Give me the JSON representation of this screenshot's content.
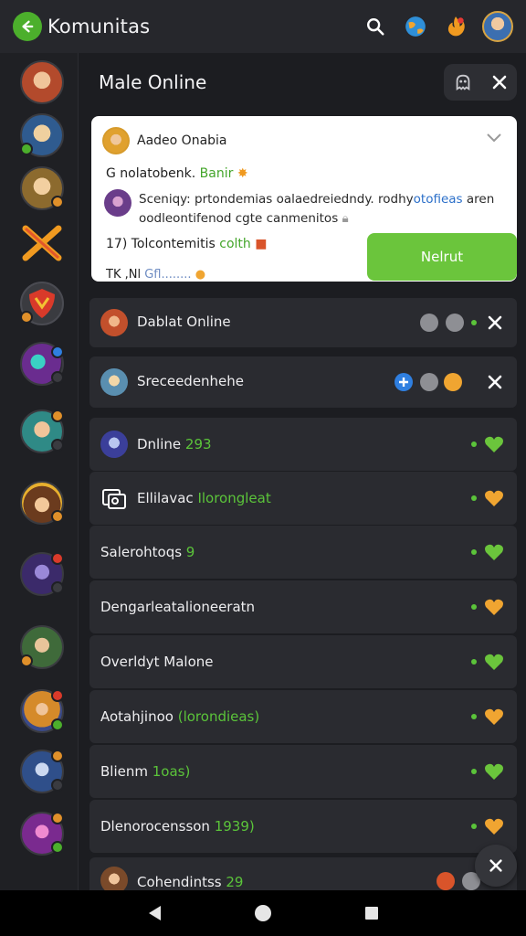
{
  "topbar": {
    "title": "Komunitas",
    "icons": [
      "back-arrow-icon",
      "search-icon",
      "globe-icon",
      "flame-icon",
      "profile-avatar"
    ],
    "accent": "#4caf2c"
  },
  "section": {
    "title": "Male Online",
    "icons": [
      "ghost-icon",
      "close-icon"
    ]
  },
  "card": {
    "name": "Aadeo Onabia",
    "line1_prefix": "G nolatobenk.",
    "line1_highlight": "Banir",
    "message_part1": "Sceniqy: prtondemias oalaedreiedndy. rodhy",
    "message_highlight": "otofieas",
    "message_part2": " aren oodleontifenod cgte canmenitos",
    "line3_prefix": "17) Tolcontemitis",
    "line3_highlight": "colth",
    "line4_prefix": "TK ,Nl",
    "line4_highlight": "Gfl........",
    "action_label": "Nelrut",
    "button_color": "#6bc53c"
  },
  "rows": [
    {
      "label": "Dablat Online",
      "highlight": "",
      "trail": "status-dots",
      "closable": true
    },
    {
      "label": "Sreceedenhehe",
      "highlight": "",
      "trail": "status-dots",
      "closable": true
    },
    {
      "label": "Dnline ",
      "highlight": "293",
      "trail": "heart-green",
      "closable": false
    },
    {
      "label": "Ellilavac ",
      "highlight": "Ilorongleat",
      "trail": "heart-orange",
      "closable": false
    },
    {
      "label": "Salerohtoqs ",
      "highlight": "9",
      "trail": "heart-green",
      "closable": false
    },
    {
      "label": "Dengarleatalioneeratn",
      "highlight": "",
      "trail": "heart-orange",
      "closable": false
    },
    {
      "label": "Overldyt Malone",
      "highlight": "",
      "trail": "heart-green",
      "closable": false
    },
    {
      "label": "Aotahjinoo ",
      "highlight": "(lorondieas)",
      "trail": "heart-orange",
      "closable": false
    },
    {
      "label": "Blienm ",
      "highlight": "1oas)",
      "trail": "heart-green",
      "closable": false
    },
    {
      "label": "Dlenorocensson ",
      "highlight": "1939)",
      "trail": "heart-orange",
      "closable": false
    },
    {
      "label": "Cohendintss ",
      "highlight": "29",
      "trail": "status-dots",
      "closable": false
    }
  ],
  "navbar": {
    "icons": [
      "back-triangle-icon",
      "home-circle-icon",
      "recents-square-icon"
    ]
  }
}
